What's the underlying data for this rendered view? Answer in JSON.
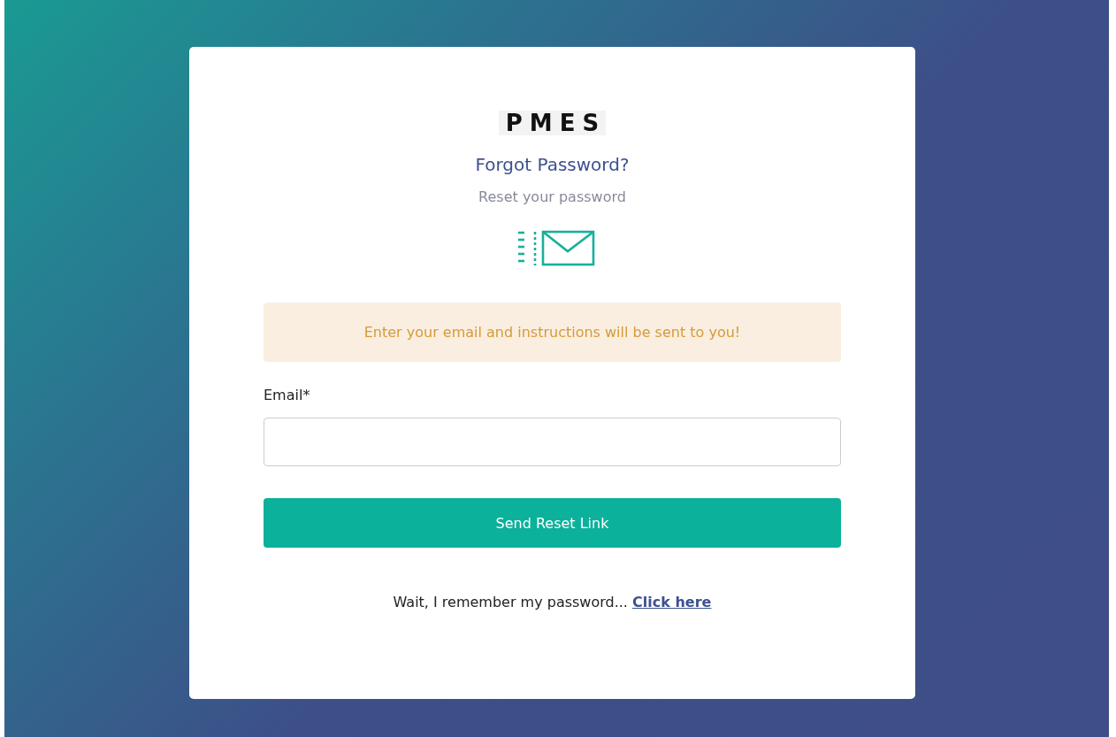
{
  "logo": {
    "text": "PMES"
  },
  "title": "Forgot Password?",
  "subtitle": "Reset your password",
  "alert": {
    "text": "Enter your email and instructions will be sent to you!"
  },
  "form": {
    "email": {
      "label": "Email*"
    },
    "submit": "Send Reset Link"
  },
  "footer": {
    "text": "Wait, I remember my password...",
    "link": "Click here"
  }
}
